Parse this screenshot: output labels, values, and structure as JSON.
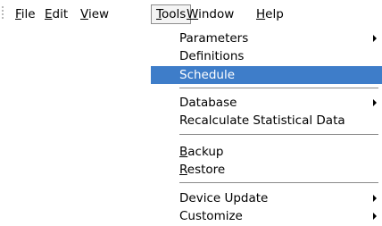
{
  "menubar": {
    "file": {
      "mn": "F",
      "rest": "ile"
    },
    "edit": {
      "mn": "E",
      "rest": "dit"
    },
    "view": {
      "mn": "V",
      "rest": "iew"
    },
    "tools": {
      "mn": "T",
      "rest": "ools"
    },
    "window": {
      "mn": "W",
      "rest": "indow"
    },
    "help": {
      "mn": "H",
      "rest": "elp"
    }
  },
  "tools_menu": {
    "parameters": "Parameters",
    "definitions": "Definitions",
    "schedule": "Schedule",
    "database": "Database",
    "recalculate": "Recalculate Statistical Data",
    "backup": {
      "mn": "B",
      "rest": "ackup"
    },
    "restore": {
      "mn": "R",
      "rest": "estore"
    },
    "device_update": "Device Update",
    "customize": "Customize"
  },
  "colors": {
    "highlight": "#3e7dc9",
    "separator": "#8a8a8a"
  }
}
